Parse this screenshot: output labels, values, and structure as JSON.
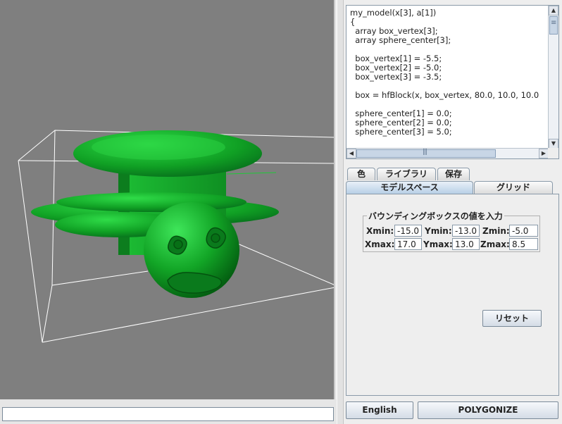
{
  "viewport": {
    "background": "#7f7f7f",
    "model_color": "#16a82a",
    "wire_color": "#ffffff"
  },
  "command_input": {
    "value": ""
  },
  "editor": {
    "lines": [
      "my_model(x[3], a[1])",
      "{",
      "  array box_vertex[3];",
      "  array sphere_center[3];",
      "",
      "  box_vertex[1] = -5.5;",
      "  box_vertex[2] = -5.0;",
      "  box_vertex[3] = -3.5;",
      "",
      "  box = hfBlock(x, box_vertex, 80.0, 10.0, 10.0",
      "",
      "  sphere_center[1] = 0.0;",
      "  sphere_center[2] = 0.0;",
      "  sphere_center[3] = 5.0;"
    ]
  },
  "tabs": {
    "row1": [
      "色",
      "ライブラリ",
      "保存"
    ],
    "row2": [
      "モデルスペース",
      "グリッド"
    ],
    "active": "モデルスペース"
  },
  "bounding_box": {
    "title": "バウンディングボックスの値を入力",
    "xmin_label": "Xmin:",
    "xmin": "-15.0",
    "ymin_label": "Ymin:",
    "ymin": "-13.0",
    "zmin_label": "Zmin:",
    "zmin": "-5.0",
    "xmax_label": "Xmax:",
    "xmax": "17.0",
    "ymax_label": "Ymax:",
    "ymax": "13.0",
    "zmax_label": "Zmax:",
    "zmax": "8.5"
  },
  "buttons": {
    "reset": "リセット",
    "english": "English",
    "polygonize": "POLYGONIZE"
  }
}
